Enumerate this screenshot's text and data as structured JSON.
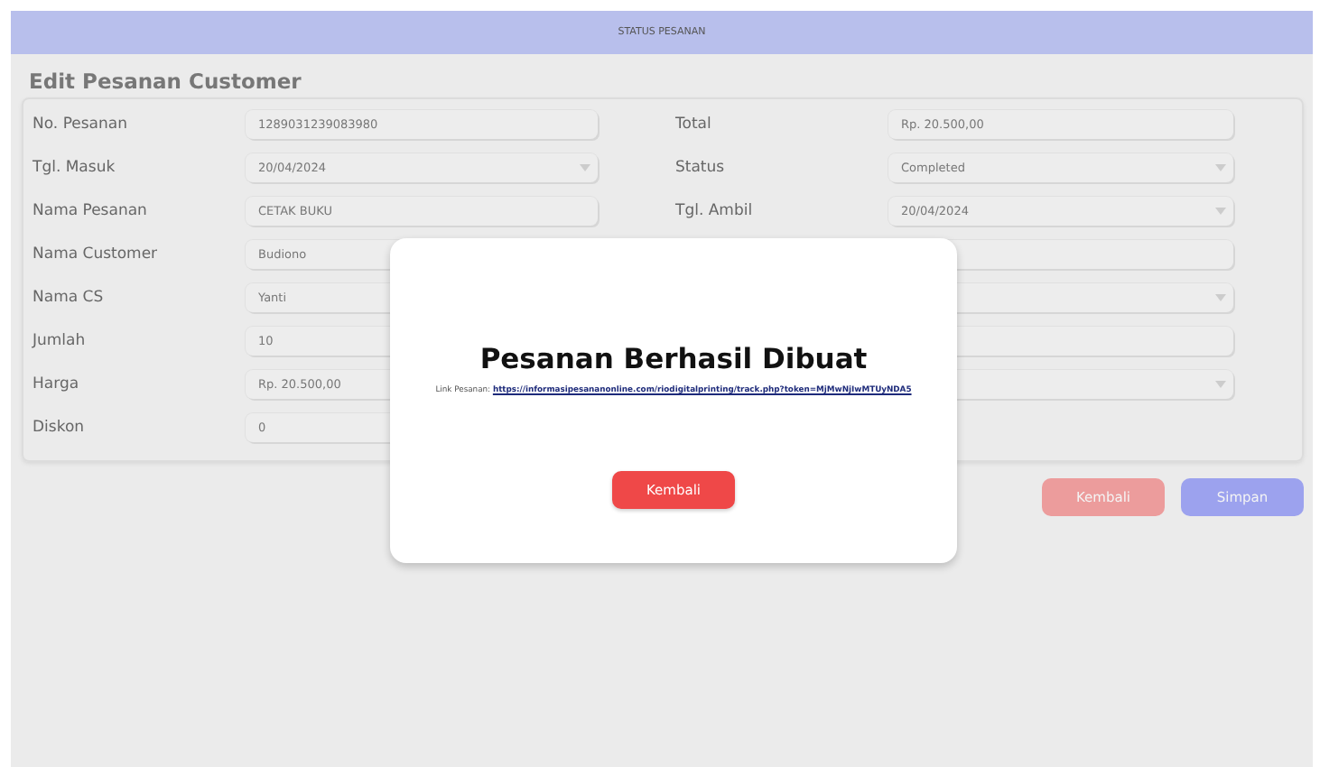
{
  "header": {
    "title": "STATUS PESANAN"
  },
  "form": {
    "title": "Edit Pesanan Customer",
    "left": [
      {
        "label": "No. Pesanan",
        "value": "1289031239083980",
        "kind": "text"
      },
      {
        "label": "Tgl. Masuk",
        "value": "20/04/2024",
        "kind": "select"
      },
      {
        "label": "Nama Pesanan",
        "value": "CETAK BUKU",
        "kind": "text"
      },
      {
        "label": "Nama Customer",
        "value": "Budiono",
        "kind": "text"
      },
      {
        "label": "Nama CS",
        "value": "Yanti",
        "kind": "text"
      },
      {
        "label": "Jumlah",
        "value": "10",
        "kind": "text"
      },
      {
        "label": "Harga",
        "value": "Rp. 20.500,00",
        "kind": "text"
      },
      {
        "label": "Diskon",
        "value": "0",
        "kind": "text"
      }
    ],
    "right": [
      {
        "label": "Total",
        "value": "Rp. 20.500,00",
        "kind": "text"
      },
      {
        "label": "Status",
        "value": "Completed",
        "kind": "select"
      },
      {
        "label": "Tgl. Ambil",
        "value": "20/04/2024",
        "kind": "select"
      },
      {
        "kind": "text"
      },
      {
        "kind": "select"
      },
      {
        "kind": "text"
      },
      {
        "kind": "select"
      }
    ]
  },
  "buttons": [
    {
      "label": "Kembali",
      "kind": "secondary"
    },
    {
      "label": "Simpan",
      "kind": "primary"
    }
  ],
  "modal": {
    "title": "Pesanan Berhasil Dibuat",
    "link_label": "Link Pesanan:",
    "link": "https://informasipesananonline.com/riodigitalprinting/track.php?token=MjMwNjIwMTUyNDA5",
    "button": "Kembali"
  }
}
